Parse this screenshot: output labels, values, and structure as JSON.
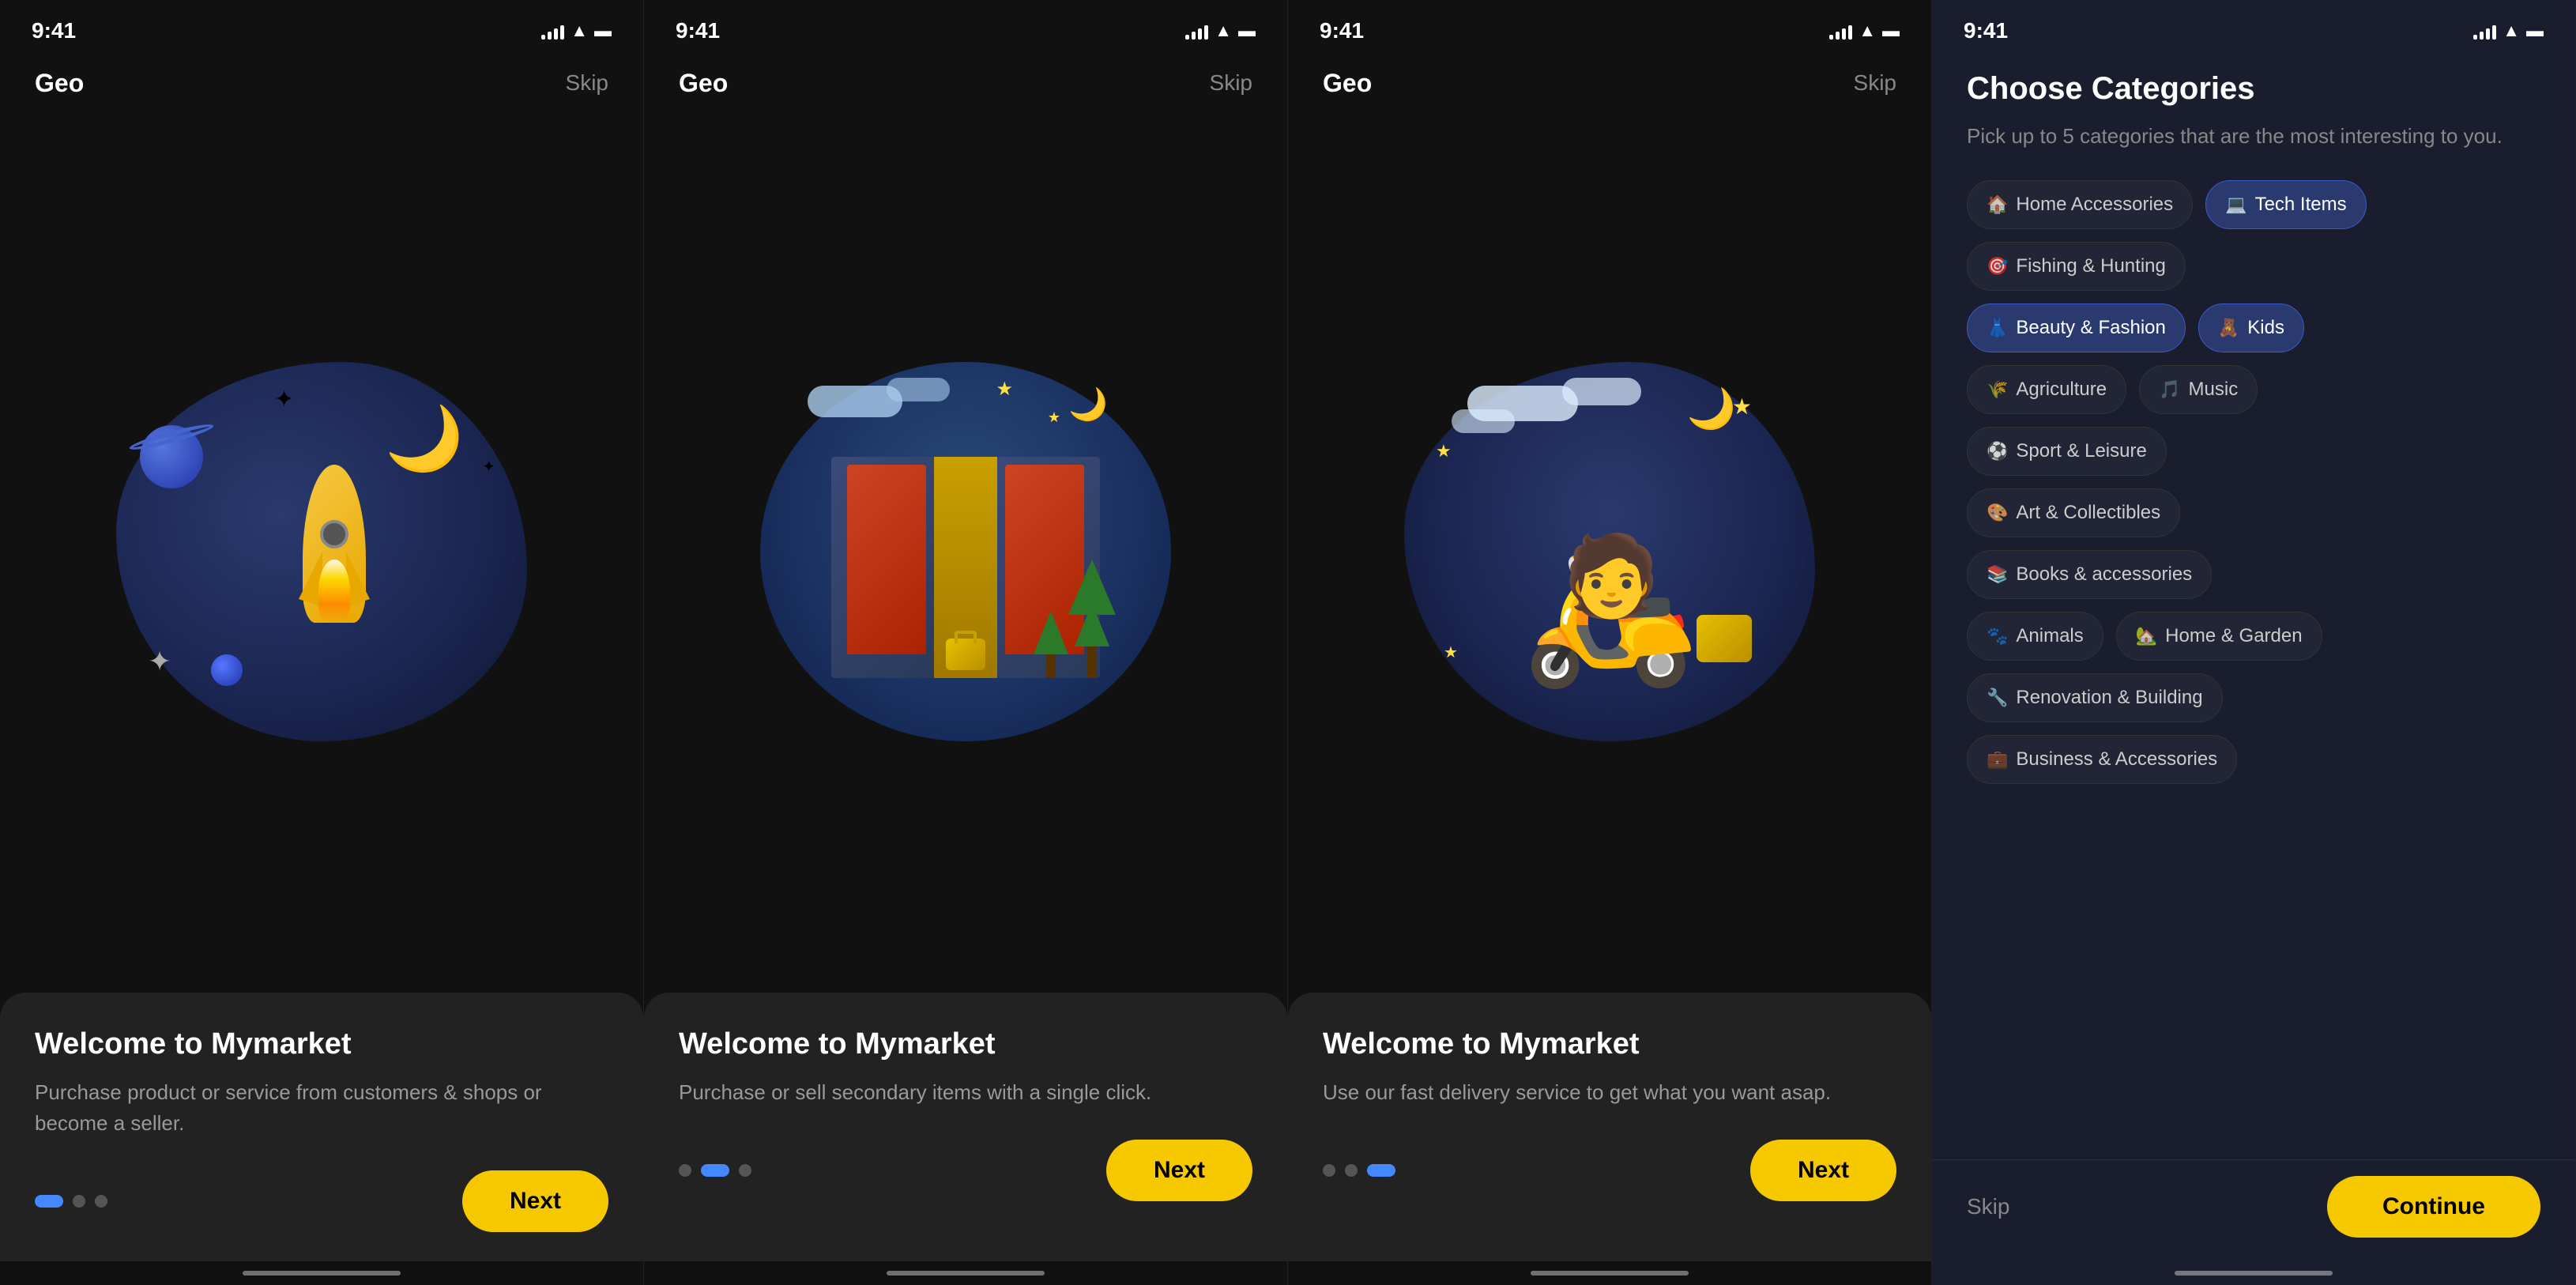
{
  "screens": [
    {
      "id": "screen1",
      "statusTime": "9:41",
      "brandName": "Geo",
      "skipLabel": "Skip",
      "cardTitle": "Welcome to Mymarket",
      "cardText": "Purchase product or service from customers & shops or become a seller.",
      "nextLabel": "Next",
      "dots": [
        "active",
        "inactive",
        "inactive"
      ],
      "illustrationAlt": "rocket in space"
    },
    {
      "id": "screen2",
      "statusTime": "9:41",
      "brandName": "Geo",
      "skipLabel": "Skip",
      "cardTitle": "Welcome to Mymarket",
      "cardText": "Purchase or sell secondary items with a single click.",
      "nextLabel": "Next",
      "dots": [
        "inactive",
        "active",
        "inactive"
      ],
      "illustrationAlt": "door with suitcase"
    },
    {
      "id": "screen3",
      "statusTime": "9:41",
      "brandName": "Geo",
      "skipLabel": "Skip",
      "cardTitle": "Welcome to Mymarket",
      "cardText": "Use our fast delivery service to get what you want asap.",
      "nextLabel": "Next",
      "dots": [
        "inactive",
        "inactive",
        "active"
      ],
      "illustrationAlt": "scooter delivery"
    },
    {
      "id": "screen4",
      "statusTime": "9:41",
      "categoriesTitle": "Choose Categories",
      "categoriesSubtitle": "Pick up to 5 categories that are the most interesting to you.",
      "categories": [
        {
          "label": "Home Accessories",
          "icon": "🏠",
          "selected": false
        },
        {
          "label": "Tech Items",
          "icon": "💻",
          "selected": true
        },
        {
          "label": "Fishing & Hunting",
          "icon": "🎯",
          "selected": false
        },
        {
          "label": "Beauty & Fashion",
          "icon": "👗",
          "selected": true
        },
        {
          "label": "Kids",
          "icon": "🧸",
          "selected": true
        },
        {
          "label": "Agriculture",
          "icon": "🌾",
          "selected": false
        },
        {
          "label": "Music",
          "icon": "🎵",
          "selected": false
        },
        {
          "label": "Sport & Leisure",
          "icon": "⚽",
          "selected": false
        },
        {
          "label": "Art & Collectibles",
          "icon": "🎨",
          "selected": false
        },
        {
          "label": "Books & accessories",
          "icon": "📚",
          "selected": false
        },
        {
          "label": "Animals",
          "icon": "🐾",
          "selected": false
        },
        {
          "label": "Home & Garden",
          "icon": "🏡",
          "selected": false
        },
        {
          "label": "Renovation & Building",
          "icon": "🔧",
          "selected": false
        },
        {
          "label": "Business & Accessories",
          "icon": "💼",
          "selected": false
        }
      ],
      "skipLabel": "Skip",
      "continueLabel": "Continue"
    }
  ]
}
